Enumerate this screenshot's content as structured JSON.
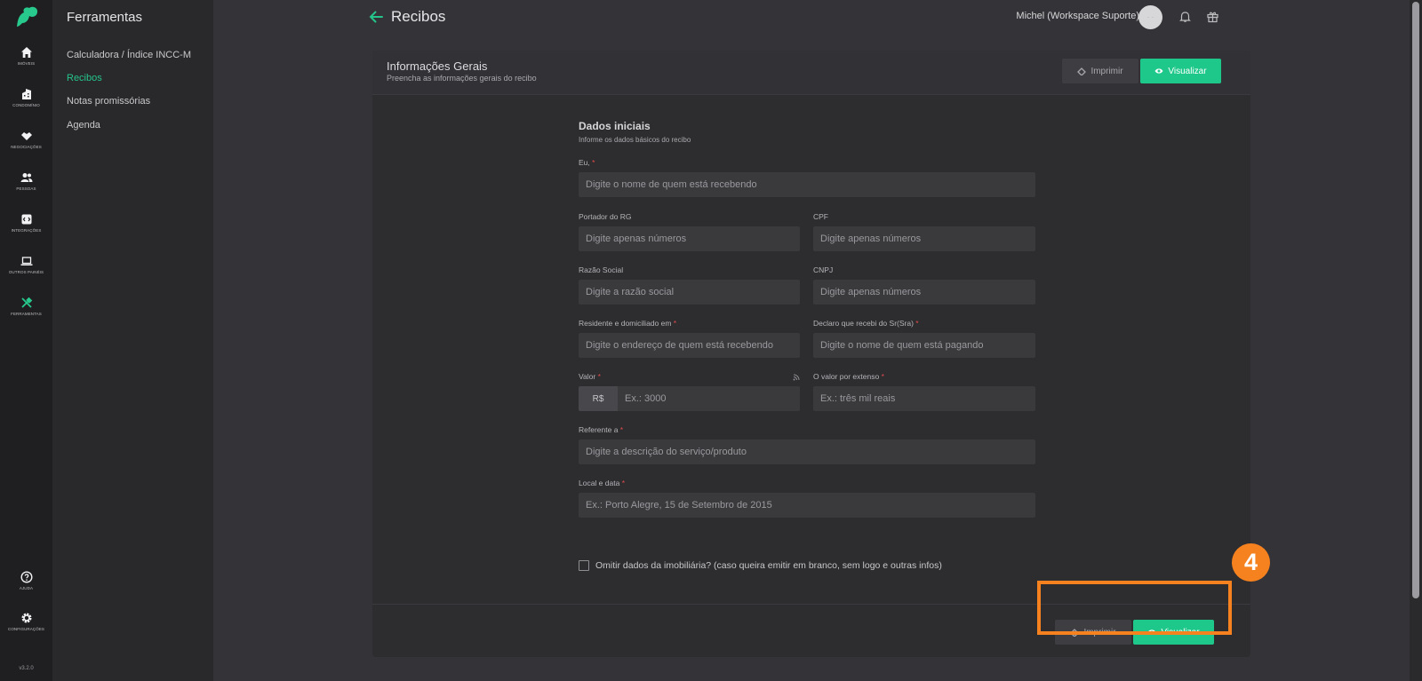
{
  "rail": {
    "items": [
      {
        "label": "Imóveis",
        "icon": "home-icon"
      },
      {
        "label": "Condomínio",
        "icon": "building-icon"
      },
      {
        "label": "Negociações",
        "icon": "handshake-icon"
      },
      {
        "label": "Pessoas",
        "icon": "people-icon"
      },
      {
        "label": "Integrações",
        "icon": "integration-icon"
      },
      {
        "label": "Outros Painéis",
        "icon": "laptop-icon"
      },
      {
        "label": "Ferramentas",
        "icon": "tools-icon"
      }
    ],
    "help_label": "Ajuda",
    "settings_label": "Configurações",
    "version": "v3.2.0"
  },
  "sidebar": {
    "title": "Ferramentas",
    "items": [
      {
        "label": "Calculadora / Índice INCC-M"
      },
      {
        "label": "Recibos"
      },
      {
        "label": "Notas promissórias"
      },
      {
        "label": "Agenda"
      }
    ]
  },
  "header": {
    "title": "Recibos",
    "user": "Michel (Workspace Suporte)",
    "avatar_text": "· ·"
  },
  "card": {
    "title": "Informações Gerais",
    "subtitle": "Preencha as informações gerais do recibo",
    "print_label": "Imprimir",
    "view_label": "Visualizar"
  },
  "form": {
    "title": "Dados iniciais",
    "subtitle": "Informe os dados básicos do recibo",
    "fields": {
      "eu": {
        "label": "Eu,",
        "placeholder": "Digite o nome de quem está recebendo"
      },
      "rg": {
        "label": "Portador do RG",
        "placeholder": "Digite apenas números"
      },
      "cpf": {
        "label": "CPF",
        "placeholder": "Digite apenas números"
      },
      "razao": {
        "label": "Razão Social",
        "placeholder": "Digite a razão social"
      },
      "cnpj": {
        "label": "CNPJ",
        "placeholder": "Digite apenas números"
      },
      "residente": {
        "label": "Residente e domiciliado em",
        "placeholder": "Digite o endereço de quem está recebendo"
      },
      "declaro": {
        "label": "Declaro que recebi do Sr(Sra)",
        "placeholder": "Digite o nome de quem está pagando"
      },
      "valor": {
        "label": "Valor",
        "prefix": "R$",
        "placeholder": "Ex.: 3000"
      },
      "extenso": {
        "label": "O valor por extenso",
        "placeholder": "Ex.: três mil reais"
      },
      "referente": {
        "label": "Referente a",
        "placeholder": "Digite a descrição do serviço/produto"
      },
      "local": {
        "label": "Local e data",
        "placeholder": "Ex.: Porto Alegre, 15 de Setembro de 2015"
      }
    },
    "required_mark": "*",
    "omit_label": "Omitir dados da imobiliária? (caso queira emitir em branco, sem logo e outras infos)"
  },
  "annotation": {
    "step": "4"
  },
  "colors": {
    "accent": "#1ec88a",
    "highlight": "#f5821f"
  }
}
